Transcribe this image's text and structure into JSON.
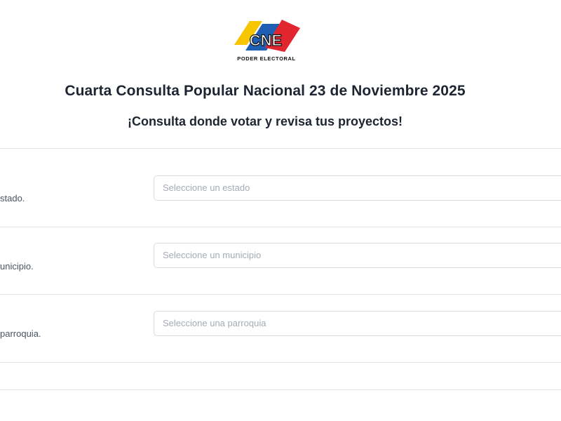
{
  "header": {
    "logo_text": "CNE",
    "logo_subtext": "PODER ELECTORAL",
    "title": "Cuarta Consulta Popular Nacional 23 de Noviembre 2025",
    "subtitle": "¡Consulta donde votar y revisa tus proyectos!"
  },
  "form": {
    "rows": [
      {
        "label": "stado.",
        "placeholder": "Seleccione un estado"
      },
      {
        "label": "unicipio.",
        "placeholder": "Seleccione un municipio"
      },
      {
        "label": "parroquia.",
        "placeholder": "Seleccione una parroquia"
      }
    ]
  },
  "colors": {
    "logo_yellow": "#f6c500",
    "logo_blue": "#1e5fb4",
    "logo_red": "#e2262f",
    "text_dark": "#1e2532",
    "placeholder": "#a4abb5",
    "border": "#d6dbe0"
  }
}
